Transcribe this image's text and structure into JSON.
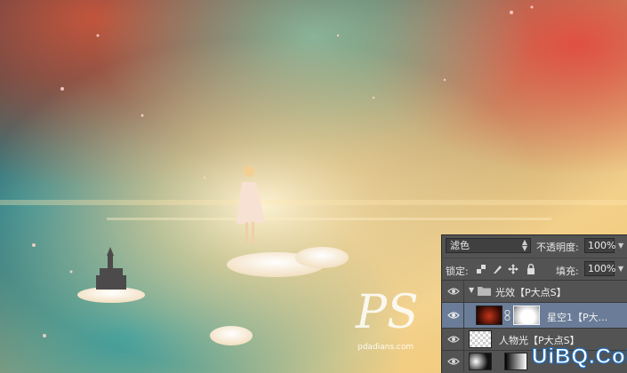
{
  "layers_panel": {
    "blend_mode": "滤色",
    "opacity_label": "不透明度:",
    "opacity_value": "100%",
    "lock_label": "锁定:",
    "fill_label": "填充:",
    "fill_value": "100%",
    "layers": [
      {
        "name": "光效【P大点S】",
        "kind": "group",
        "expanded": true,
        "visible": true
      },
      {
        "name": "星空1【P大...",
        "kind": "image",
        "selected": true,
        "visible": true
      },
      {
        "name": "人物光【P大点S】",
        "kind": "image",
        "visible": true
      },
      {
        "name": "",
        "kind": "image",
        "visible": true
      }
    ]
  },
  "watermarks": {
    "ps_logo": "PS",
    "ps_site": "pdadians.com",
    "uibq": "UiBQ.CoM"
  },
  "colors": {
    "panel_bg": "#535353",
    "selected_row": "#6a7c97",
    "field_bg": "#404040"
  }
}
